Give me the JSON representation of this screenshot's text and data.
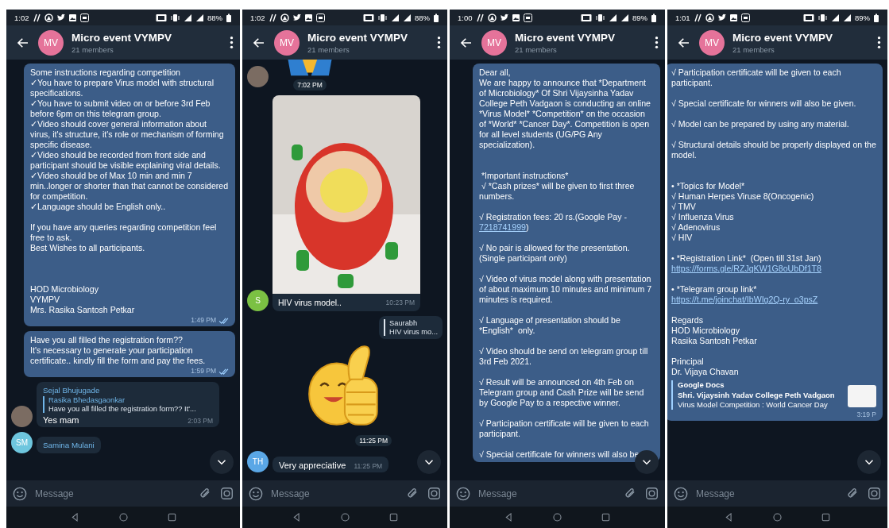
{
  "screens": [
    {
      "status_bar": {
        "time": "1:02",
        "battery": "88%"
      },
      "header": {
        "avatar": {
          "initials": "MV",
          "color": "#e5739a"
        },
        "title": "Micro event VYMPV",
        "subtitle": "21 members"
      },
      "messages": [
        {
          "kind": "outgoing",
          "parts": [
            {
              "kind": "text",
              "text": "Some instructions regarding competition\n✓You have to prepare Virus model with structural specifications.\n✓You have to submit video on or before 3rd Feb before 6pm on this telegram group.\n✓Video should cover general information about virus, it's structure, it's role or mechanism of forming specific disease.\n✓Video should be recorded from front side and participant should be visible explaining viral details.\n✓Video should be of Max 10 min and min 7 min..longer or shorter than that cannot be considered for competition.\n✓Language should be English only..\n\nIf you have any queries regarding competition feel free to ask.\nBest Wishes to all participants.\n\n\n\nHOD Microbiology\nVYMPV\nMrs. Rasika Santosh Petkar"
            }
          ],
          "time": "1:49 PM",
          "read": true
        },
        {
          "kind": "outgoing",
          "parts": [
            {
              "kind": "text",
              "text": "Have you all filled the registration form??\nIt's necessary to generate your participation certificate.. kindly fill the form and pay the fees."
            }
          ],
          "time": "1:59 PM",
          "read": true
        },
        {
          "kind": "incoming",
          "avatar": {
            "kind": "photo"
          },
          "sender": "Sejal Bhujugade",
          "reply": {
            "name": "Rasika Bhedasgaonkar",
            "text": "Have you all filled the registration form?? It'..."
          },
          "text": "Yes mam",
          "time": "2:03 PM"
        },
        {
          "kind": "incoming",
          "avatar": {
            "kind": "initials",
            "initials": "SM",
            "color": "#6ec6de"
          },
          "sender": "Samina Mulani"
        }
      ],
      "input": {
        "placeholder": "Message"
      }
    },
    {
      "status_bar": {
        "time": "1:02",
        "battery": "88%"
      },
      "header": {
        "avatar": {
          "initials": "MV",
          "color": "#e5739a"
        },
        "title": "Micro event VYMPV",
        "subtitle": "21 members"
      },
      "messages": [
        {
          "kind": "sticker",
          "sticker": {
            "kind": "hands"
          },
          "avatar": {
            "kind": "photo"
          },
          "time": "7:02 PM"
        },
        {
          "kind": "photo",
          "avatar": {
            "kind": "initials",
            "initials": "S",
            "color": "#7bc143"
          },
          "caption": "HIV virus model..",
          "time": "10:23 PM"
        },
        {
          "kind": "reply",
          "reply": {
            "name": "Saurabh",
            "text": "HIV virus mo..."
          }
        },
        {
          "kind": "sticker",
          "sticker": {
            "kind": "thumbs"
          },
          "time": "11:25 PM"
        },
        {
          "kind": "incoming",
          "avatar": {
            "kind": "initials",
            "initials": "TH",
            "color": "#5aa7e6"
          },
          "text": "Very appreciative",
          "time": "11:25 PM"
        }
      ],
      "input": {
        "placeholder": "Message"
      }
    },
    {
      "status_bar": {
        "time": "1:00",
        "battery": "89%"
      },
      "header": {
        "avatar": {
          "initials": "MV",
          "color": "#e5739a"
        },
        "title": "Micro event VYMPV",
        "subtitle": "21 members"
      },
      "messages": [
        {
          "kind": "outgoing",
          "parts": [
            {
              "kind": "text",
              "text": "Dear all,\nWe are happy to announce that *Department of Microbiology* Of Shri Vijaysinha Yadav College Peth Vadgaon is conducting an online *Virus Model* *Competition* on the occasion of *World* *Cancer Day*. Competition is open for all level students (UG/PG Any specialization).\n\n\n *Important instructions*\n √ *Cash prizes* will be given to first three numbers.\n\n√ Registration fees: 20 rs.(Google Pay - "
            },
            {
              "kind": "link",
              "text": "7218741999"
            },
            {
              "kind": "text",
              "text": ")\n\n√ No pair is allowed for the presentation.\n(Single participant only)\n\n√ Video of virus model along with presentation of about maximum 10 minutes and minimum 7 minutes is required.\n\n√ Language of presentation should be\n*English*  only.\n\n√ Video should be send on telegram group till 3rd Feb 2021.\n\n√ Result will be announced on 4th Feb on Telegram group and Cash Prize will be send by Google Pay to a respective winner.\n\n√ Participation certificate will be given to each participant.\n\n√ Special certificate for winners will also be"
            }
          ]
        }
      ],
      "input": {
        "placeholder": "Message"
      }
    },
    {
      "status_bar": {
        "time": "1:01",
        "battery": "89%"
      },
      "header": {
        "avatar": {
          "initials": "MV",
          "color": "#e5739a"
        },
        "title": "Micro event VYMPV",
        "subtitle": "21 members"
      },
      "messages": [
        {
          "kind": "outgoing",
          "parts": [
            {
              "kind": "text",
              "text": "√ Participation certificate will be given to each participant.\n\n√ Special certificate for winners will also be given.\n\n√ Model can be prepared by using any material.\n\n√ Structural details should be properly displayed on the model.\n\n\n• *Topics for Model*\n√ Human Herpes Viruse 8(Oncogenic)\n√ TMV\n√ Influenza Virus\n√ Adenovirus\n√ HIV\n\n• *Registration Link*  (Open till 31st Jan)\n"
            },
            {
              "kind": "link",
              "text": "https://forms.gle/RZJqKW1G8oUbDf1T8"
            },
            {
              "kind": "text",
              "text": "\n\n• *Telegram group link*\n"
            },
            {
              "kind": "link",
              "text": "https://t.me/joinchat/IbWIg2Q-ry_o3psZ"
            },
            {
              "kind": "text",
              "text": "\n\nRegards\nHOD Microbiology\nRasika Santosh Petkar\n\nPrincipal\nDr. Vijaya Chavan"
            }
          ],
          "preview": {
            "site": "Google Docs",
            "title": "Shri. Vijaysinh Yadav College Peth Vadgaon",
            "description": "Virus Model Competition : World Cancer Day"
          },
          "time": "3:19 P"
        }
      ],
      "input": {
        "placeholder": "Message"
      }
    }
  ]
}
